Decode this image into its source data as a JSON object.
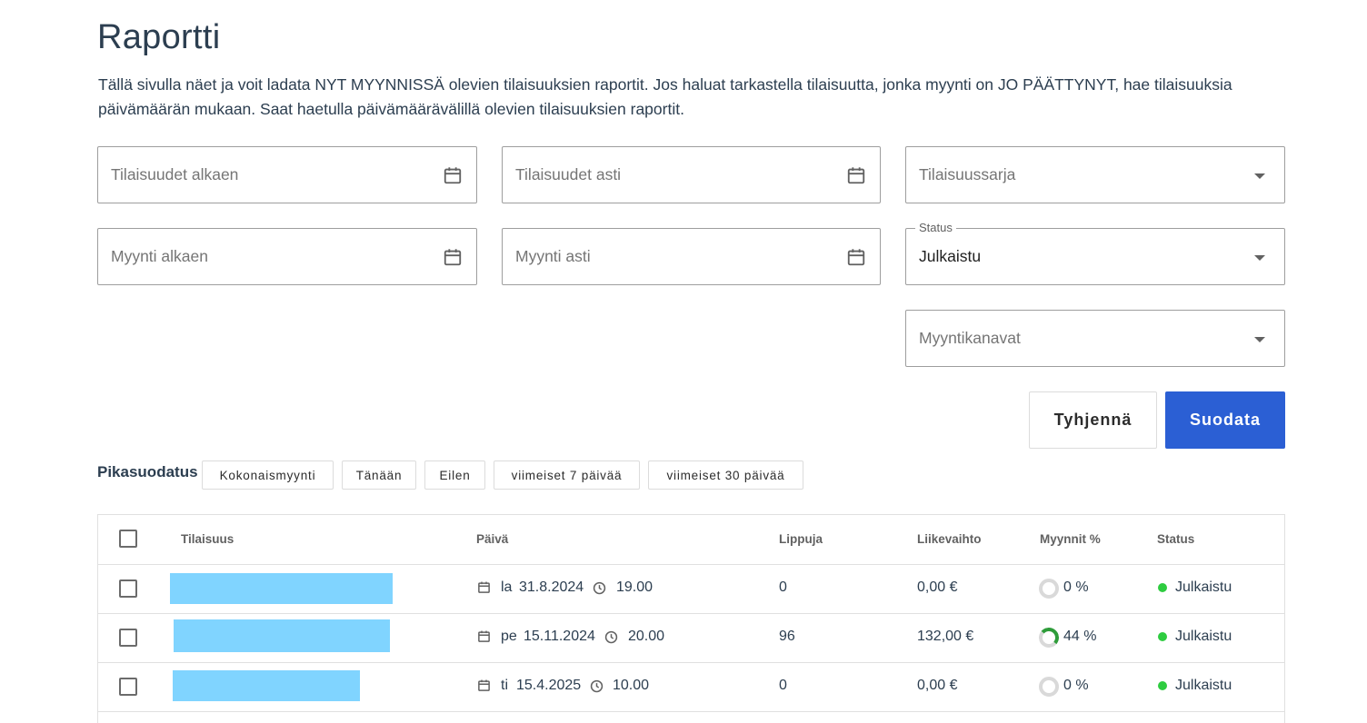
{
  "page": {
    "title": "Raportti",
    "intro": "Tällä sivulla näet ja voit ladata NYT MYYNNISSÄ olevien tilaisuuksien raportit. Jos haluat tarkastella tilaisuutta, jonka myynti on JO PÄÄTTYNYT, hae tilaisuuksia päivämäärän mukaan. Saat haetulla päivämäärävälillä olevien tilaisuuksien raportit."
  },
  "filters": {
    "events_from": "Tilaisuudet alkaen",
    "events_to": "Tilaisuudet asti",
    "series": "Tilaisuussarja",
    "sales_from": "Myynti alkaen",
    "sales_to": "Myynti asti",
    "status_label": "Status",
    "status_value": "Julkaistu",
    "channels": "Myyntikanavat"
  },
  "buttons": {
    "clear": "Tyhjennä",
    "filter": "Suodata"
  },
  "quick": {
    "label": "Pikasuodatus",
    "chips": [
      "Kokonaismyynti",
      "Tänään",
      "Eilen",
      "viimeiset 7 päivää",
      "viimeiset 30 päivää"
    ]
  },
  "table": {
    "headers": [
      "Tilaisuus",
      "Päivä",
      "Lippuja",
      "Liikevaihto",
      "Myynnit %",
      "Status"
    ],
    "rows": [
      {
        "weekday": "la",
        "date": "31.8.2024",
        "time": "19.00",
        "tickets": "0",
        "revenue": "0,00 €",
        "percent": "0 %",
        "sales_fraction": 0,
        "status": "Julkaistu"
      },
      {
        "weekday": "pe",
        "date": "15.11.2024",
        "time": "20.00",
        "tickets": "96",
        "revenue": "132,00 €",
        "percent": "44 %",
        "sales_fraction": 0.44,
        "status": "Julkaistu"
      },
      {
        "weekday": "ti",
        "date": "15.4.2025",
        "time": "10.00",
        "tickets": "0",
        "revenue": "0,00 €",
        "percent": "0 %",
        "sales_fraction": 0,
        "status": "Julkaistu"
      }
    ]
  },
  "colors": {
    "primary": "#2b5fd4",
    "status_published": "#2ecc40",
    "progress": "#2e9c3a",
    "redaction": "#80d4ff"
  },
  "icons": {
    "date": "calendar-icon",
    "time": "clock-icon",
    "dropdown": "chevron-down-icon"
  }
}
